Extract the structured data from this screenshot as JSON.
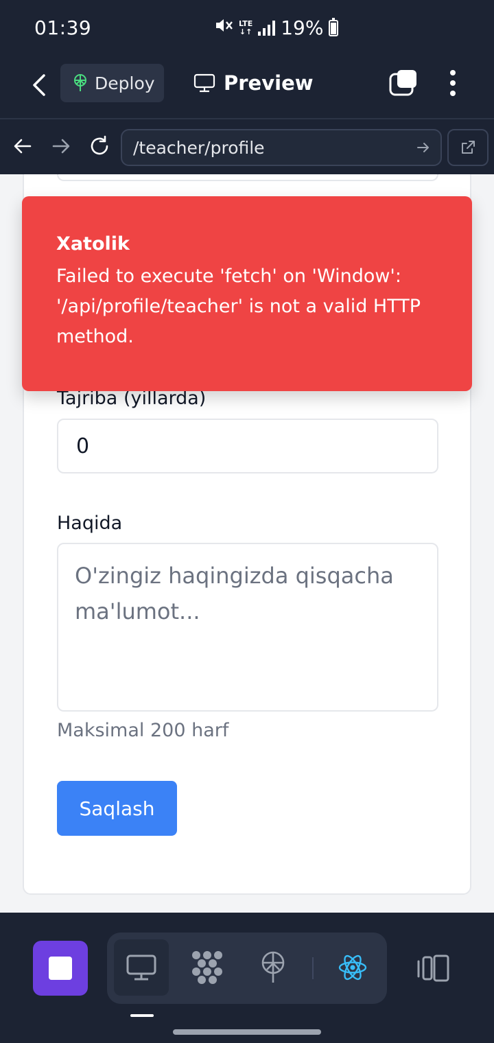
{
  "status_bar": {
    "time": "01:39",
    "network": "LTE",
    "battery": "19%"
  },
  "app_bar": {
    "deploy_label": "Deploy",
    "preview_label": "Preview"
  },
  "url_bar": {
    "url": "/teacher/profile"
  },
  "error_toast": {
    "title": "Xatolik",
    "message": "Failed to execute 'fetch' on 'Window': '/api/profile/teacher' is not a valid HTTP method."
  },
  "form": {
    "experience_label": "Tajriba (yillarda)",
    "experience_value": "0",
    "about_label": "Haqida",
    "about_placeholder": "O'zingiz haqingizda qisqacha ma'lumot...",
    "about_hint": "Maksimal 200 harf",
    "save_label": "Saqlash"
  },
  "colors": {
    "chrome_bg": "#1c2333",
    "error_bg": "#ef4444",
    "primary": "#3b82f6",
    "stop_button": "#6d3fe0",
    "react_icon": "#38bdf8"
  },
  "icons": {
    "back": "chevron-left-icon",
    "deploy": "deploy-icon",
    "preview": "monitor-icon",
    "tabs": "tabs-icon",
    "menu": "more-vertical-icon",
    "nav_back": "arrow-left-icon",
    "nav_forward": "arrow-right-icon",
    "reload": "reload-icon",
    "open_external": "external-link-icon",
    "stop": "stop-icon",
    "webview": "monitor-icon",
    "workflows": "workflow-icon",
    "deployments": "deploy-icon",
    "react": "react-icon",
    "panel": "panel-toggle-icon"
  }
}
